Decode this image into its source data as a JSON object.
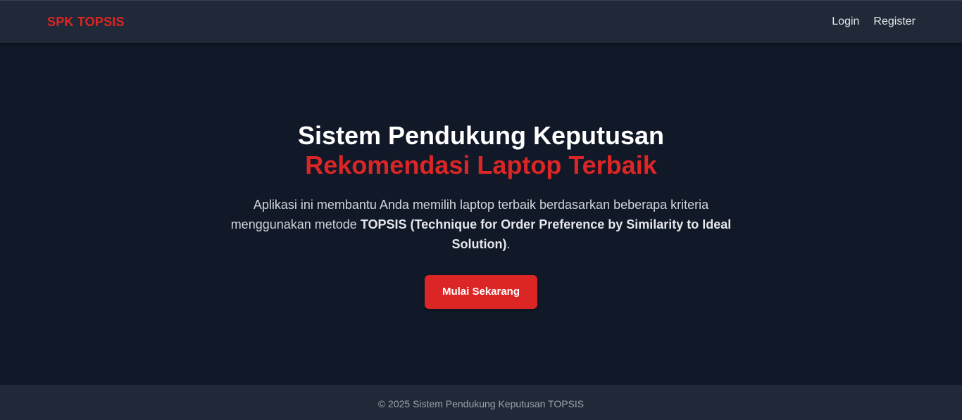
{
  "navbar": {
    "brand": "SPK TOPSIS",
    "links": [
      "Login",
      "Register"
    ]
  },
  "hero": {
    "title_line1": "Sistem Pendukung Keputusan",
    "title_line2": "Rekomendasi Laptop Terbaik",
    "desc_prefix": "Aplikasi ini membantu Anda memilih laptop terbaik berdasarkan beberapa kriteria menggunakan metode ",
    "desc_bold": "TOPSIS (Technique for Order Preference by Similarity to Ideal Solution)",
    "desc_suffix": ".",
    "cta_label": "Mulai Sekarang"
  },
  "footer": {
    "text": "© 2025 Sistem Pendukung Keputusan TOPSIS"
  },
  "colors": {
    "background": "#111827",
    "navbar": "#1f2937",
    "accent": "#dc2626",
    "text": "#ffffff",
    "muted": "#9ca3af"
  }
}
